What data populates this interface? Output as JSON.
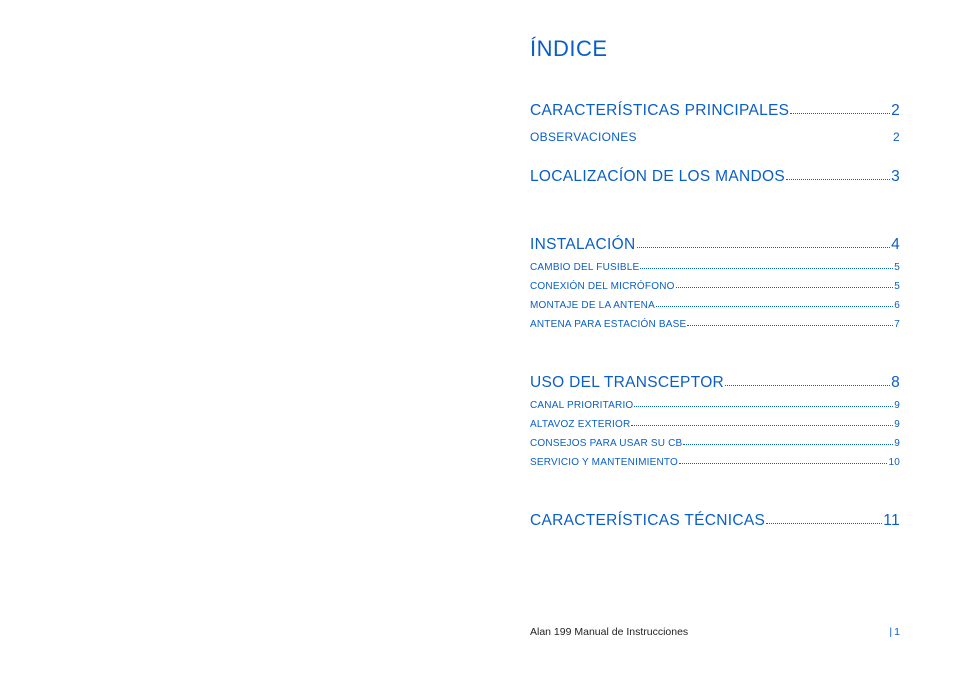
{
  "title": "ÍNDICE",
  "toc": [
    {
      "type": "main",
      "label": "CARACTERÍSTICAS PRINCIPALES",
      "page": "2",
      "leader": "dots"
    },
    {
      "type": "subbig",
      "label": "OBSERVACIONES",
      "page": "2",
      "leader": "none"
    },
    {
      "type": "main",
      "label": "LOCALIZACÍON DE LOS MANDOS",
      "page": "3",
      "leader": "dots"
    },
    {
      "type": "gap"
    },
    {
      "type": "main",
      "label": "INSTALACIÓN",
      "page": "4",
      "leader": "dots"
    },
    {
      "type": "sub",
      "label": "CAMBIO DEL FUSIBLE",
      "page": "5",
      "leader": "dots"
    },
    {
      "type": "sub",
      "label": "CONEXIÓN DEL MICRÓFONO",
      "page": "5",
      "leader": "dots"
    },
    {
      "type": "sub",
      "label": "MONTAJE DE LA ANTENA",
      "page": "6",
      "leader": "dots"
    },
    {
      "type": "sub",
      "label": "ANTENA PARA ESTACIÓN BASE",
      "page": "7",
      "leader": "dots"
    },
    {
      "type": "gap"
    },
    {
      "type": "main",
      "label": "USO DEL TRANSCEPTOR",
      "page": "8",
      "leader": "dots"
    },
    {
      "type": "sub",
      "label": "CANAL PRIORITARIO",
      "page": "9",
      "leader": "dots"
    },
    {
      "type": "sub",
      "label": "ALTAVOZ EXTERIOR",
      "page": "9",
      "leader": "dots"
    },
    {
      "type": "sub",
      "label": "CONSEJOS PARA USAR SU CB",
      "page": "9",
      "leader": "dots"
    },
    {
      "type": "sub",
      "label": "SERVICIO Y MANTENIMIENTO",
      "page": "10",
      "leader": "dots"
    },
    {
      "type": "gap"
    },
    {
      "type": "main",
      "label": "CARACTERÍSTICAS TÉCNICAS",
      "page": "11",
      "leader": "dots"
    }
  ],
  "footer": {
    "text": "Alan 199 Manual  de Instrucciones",
    "page": "1"
  }
}
